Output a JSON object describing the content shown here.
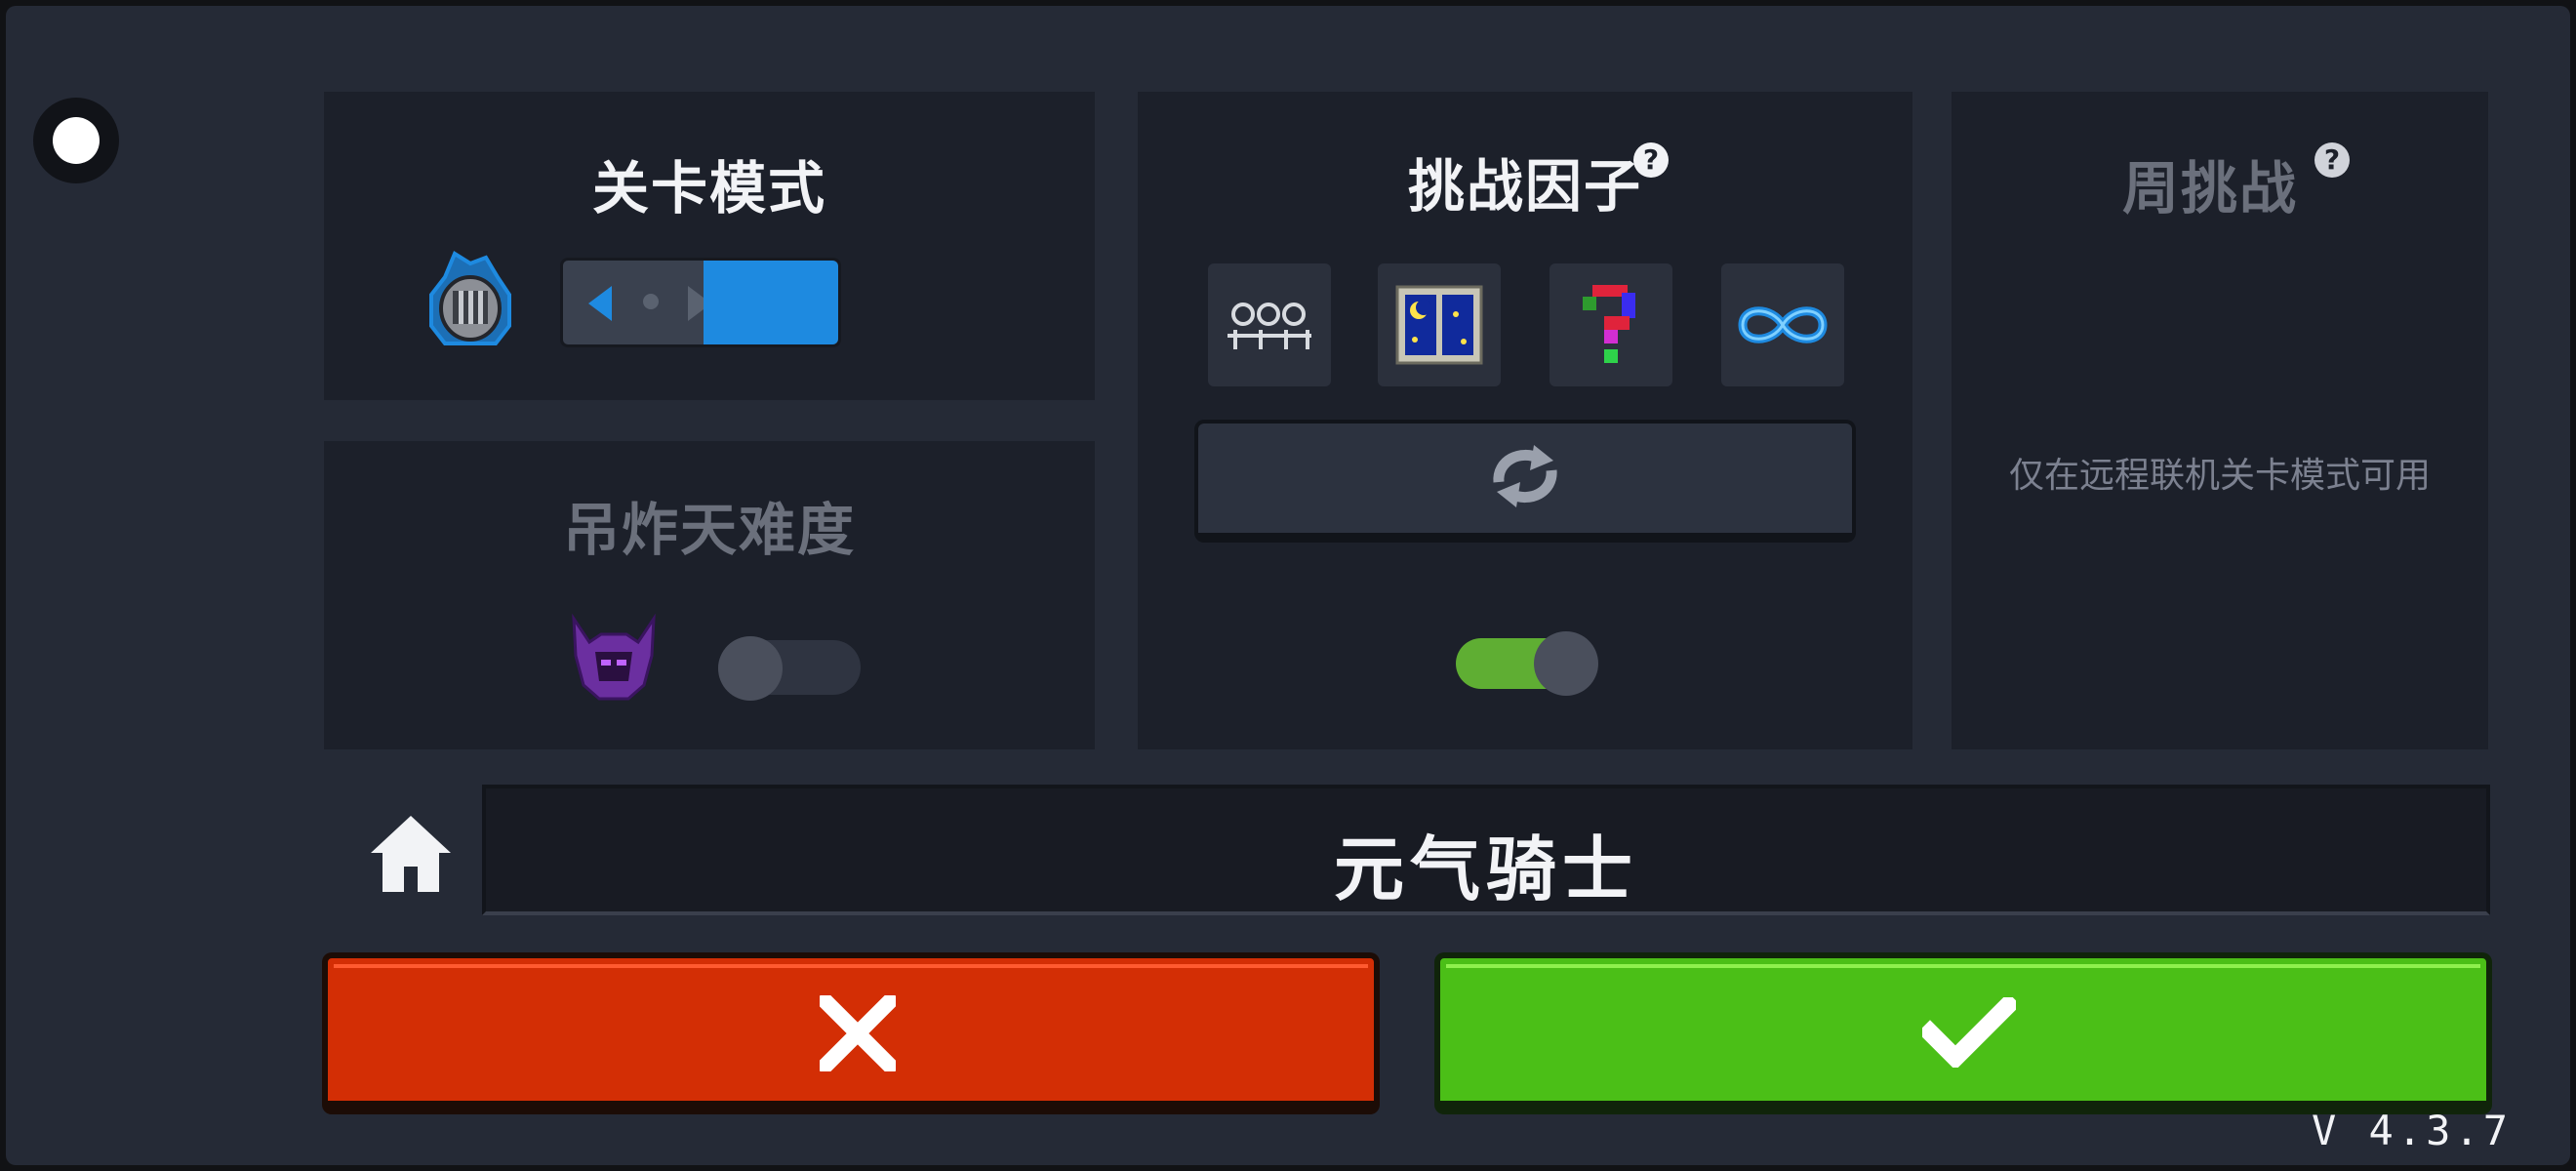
{
  "stage_mode": {
    "title": "关卡模式"
  },
  "hell_difficulty": {
    "title": "吊炸天难度",
    "enabled": false
  },
  "challenge_factors": {
    "title": "挑战因子",
    "help_icon": "question-icon",
    "factors": [
      {
        "icon": "skeleton-group-icon"
      },
      {
        "icon": "night-window-icon"
      },
      {
        "icon": "glitch-question-icon"
      },
      {
        "icon": "infinity-icon"
      }
    ],
    "refresh_icon": "refresh-icon",
    "enabled": true
  },
  "weekly_challenge": {
    "title": "周挑战",
    "help_icon": "question-icon",
    "notice": "仅在远程联机关卡模式可用"
  },
  "server": {
    "home_icon": "home-icon",
    "name": "元气骑士"
  },
  "actions": {
    "cancel_icon": "x-icon",
    "confirm_icon": "check-icon"
  },
  "version": "V 4.3.7",
  "colors": {
    "cancel": "#d32e05",
    "confirm": "#4bbf17",
    "accent_blue": "#1e8ae0",
    "toggle_on": "#5fae33"
  }
}
